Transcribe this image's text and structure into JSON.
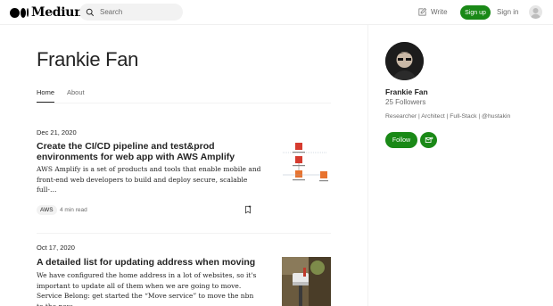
{
  "nav": {
    "logo_text": "Medium",
    "search_placeholder": "Search",
    "write_label": "Write",
    "signup_label": "Sign up",
    "signin_label": "Sign in"
  },
  "author": {
    "name": "Frankie Fan",
    "tabs": [
      {
        "label": "Home",
        "active": true
      },
      {
        "label": "About",
        "active": false
      }
    ]
  },
  "posts": [
    {
      "date": "Dec 21, 2020",
      "title": "Create the CI/CD pipeline and test&prod environments for web app with AWS Amplify",
      "excerpt": "AWS Amplify is a set of products and tools that enable mobile and front-end web developers to build and deploy secure, scalable full-…",
      "tag": "AWS",
      "read_time": "4 min read",
      "thumbnail": "architecture-diagram"
    },
    {
      "date": "Oct 17, 2020",
      "title": "A detailed list for updating address when moving",
      "excerpt": "We have configured the home address in a lot of websites, so it's important to update all of them when we are going to move. Service Belong: get started the “Move service” to move the nbn to the new…",
      "thumbnail": "mailbox-photo"
    }
  ],
  "sidebar": {
    "name": "Frankie Fan",
    "followers": "25 Followers",
    "bio": "Researcher | Architect | Full-Stack | @hustakin",
    "follow_label": "Follow"
  },
  "colors": {
    "accent_green": "#1a8917",
    "text": "#242424",
    "muted": "#6b6b6b",
    "diagram_orange": "#e8732f",
    "diagram_red": "#d63b2f"
  }
}
